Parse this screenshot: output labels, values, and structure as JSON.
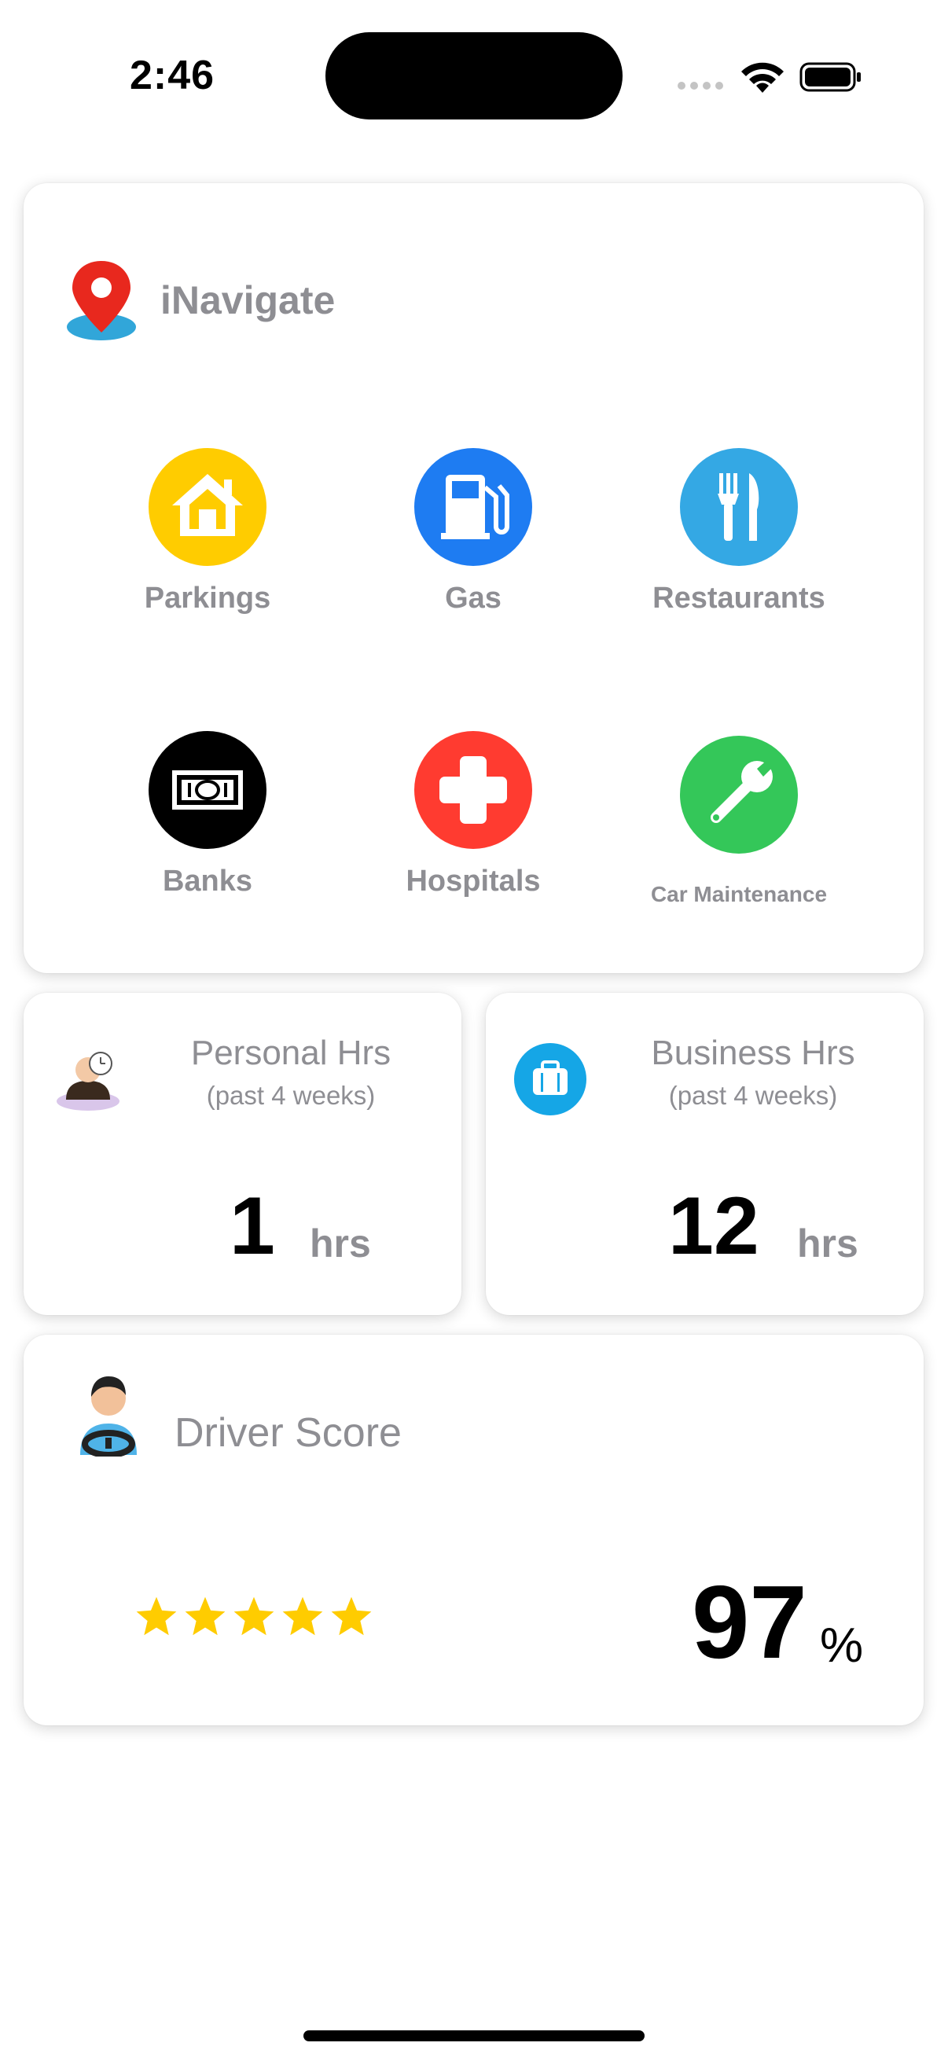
{
  "status_bar": {
    "time": "2:46"
  },
  "navigate": {
    "title": "iNavigate",
    "categories": [
      {
        "label": "Parkings",
        "icon": "house-icon",
        "color": "#FFCC00"
      },
      {
        "label": "Gas",
        "icon": "gas-pump-icon",
        "color": "#1E7CF2"
      },
      {
        "label": "Restaurants",
        "icon": "fork-knife-icon",
        "color": "#34A8E4"
      },
      {
        "label": "Banks",
        "icon": "banknote-icon",
        "color": "#000000"
      },
      {
        "label": "Hospitals",
        "icon": "medical-cross-icon",
        "color": "#FF3B30"
      },
      {
        "label": "Car Maintenance",
        "icon": "wrench-icon",
        "color": "#34C759"
      }
    ]
  },
  "personal_hrs": {
    "title": "Personal Hrs",
    "subtitle": "(past 4 weeks)",
    "value": "1",
    "unit": "hrs"
  },
  "business_hrs": {
    "title": "Business Hrs",
    "subtitle": "(past 4 weeks)",
    "value": "12",
    "unit": "hrs"
  },
  "driver_score": {
    "title": "Driver Score",
    "stars": 5,
    "value": "97",
    "unit": "%",
    "star_color": "#FFCC00"
  }
}
